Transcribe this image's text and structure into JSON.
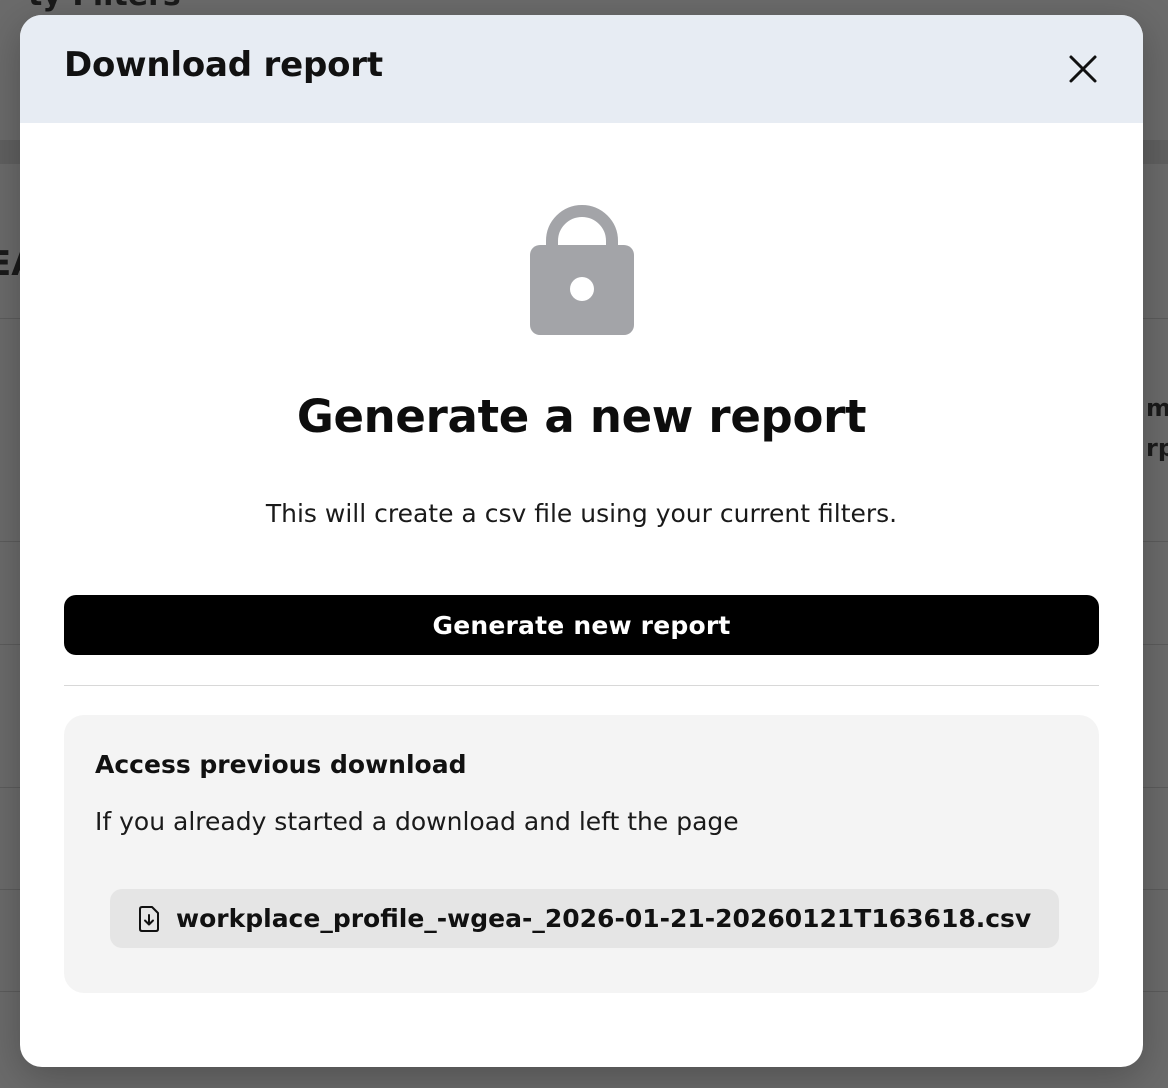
{
  "background": {
    "fragment_top": "ty Filters",
    "fragment_left": "EA",
    "fragment_right_1": "mp",
    "fragment_right_2": "rpo"
  },
  "modal": {
    "title": "Download report",
    "close_icon": "close-icon",
    "lock_icon": "lock-icon",
    "heading": "Generate a new report",
    "description": "This will create a csv file using your current filters.",
    "primary_button": "Generate new report",
    "previous": {
      "heading": "Access previous download",
      "description": "If you already started a download and left the page",
      "file_icon": "file-download-icon",
      "file_name": "workplace_profile_-wgea-_2026-01-21-20260121T163618.csv"
    }
  },
  "colors": {
    "overlay": "#6b6b6b",
    "header_bg": "#e7ecf3",
    "primary_button_bg": "#000000",
    "card_bg": "#f4f4f4",
    "chip_bg": "#e5e5e5",
    "lock_icon": "#a3a4a8"
  }
}
